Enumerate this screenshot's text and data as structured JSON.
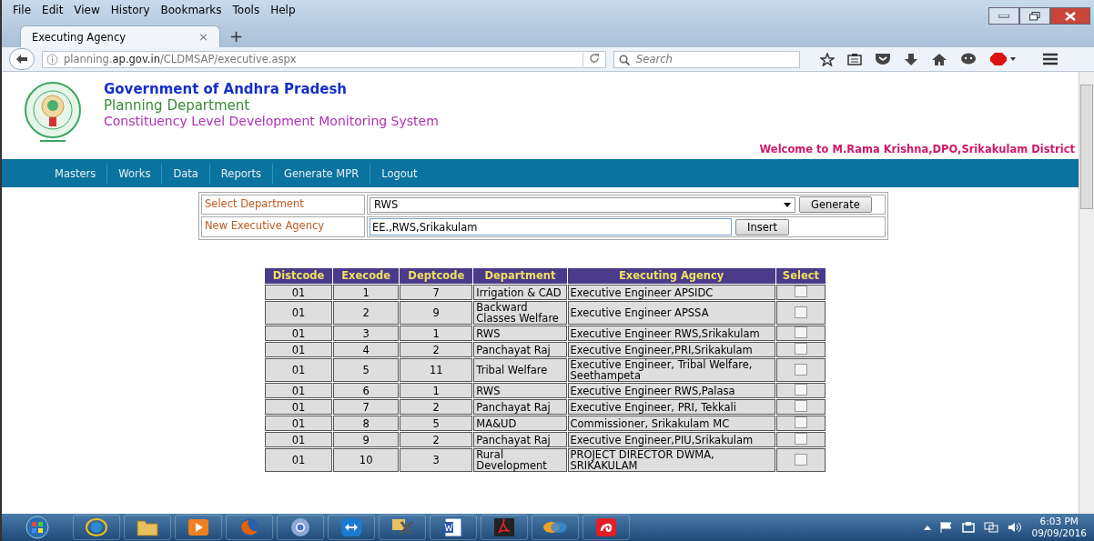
{
  "menu": [
    "File",
    "Edit",
    "View",
    "History",
    "Bookmarks",
    "Tools",
    "Help"
  ],
  "tabs": [
    {
      "label": "Executing Agency",
      "selected": true,
      "close": "×"
    }
  ],
  "new_tab": "+",
  "address": {
    "pre": "planning.",
    "host": "ap.gov.in",
    "path": "/CLDMSAP/executive.aspx"
  },
  "search": {
    "placeholder": "Search"
  },
  "header": {
    "title": "Government of Andhra Pradesh",
    "subtitle": "Planning Department",
    "system": "Constituency Level Development Monitoring System",
    "welcome": "Welcome to M.Rama Krishna,DPO,Srikakulam District"
  },
  "nav": [
    "Masters",
    "Works",
    "Data",
    "Reports",
    "Generate MPR",
    "Logout"
  ],
  "form": {
    "department_label": "Select Department",
    "department": "RWS",
    "generate": "Generate",
    "agency_label": "New Executive Agency",
    "agency": "EE.,RWS,Srikakulam",
    "insert": "Insert"
  },
  "table": {
    "columns": [
      "Distcode",
      "Execode",
      "Deptcode",
      "Department",
      "Executing Agency",
      "Select"
    ],
    "rows": [
      {
        "dist": "01",
        "exe": "1",
        "dept": "7",
        "department": "Irrigation & CAD",
        "agency": "Executive Engineer APSIDC",
        "checked": false
      },
      {
        "dist": "01",
        "exe": "2",
        "dept": "9",
        "department": "Backward Classes Welfare",
        "agency": "Executive Engineer APSSA",
        "checked": false
      },
      {
        "dist": "01",
        "exe": "3",
        "dept": "1",
        "department": "RWS",
        "agency": "Executive Engineer RWS,Srikakulam",
        "checked": false
      },
      {
        "dist": "01",
        "exe": "4",
        "dept": "2",
        "department": "Panchayat Raj",
        "agency": "Executive Engineer,PRI,Srikakulam",
        "checked": false
      },
      {
        "dist": "01",
        "exe": "5",
        "dept": "11",
        "department": "Tribal Welfare",
        "agency": "Executive Engineer, Tribal Welfare, Seethampeta",
        "checked": false
      },
      {
        "dist": "01",
        "exe": "6",
        "dept": "1",
        "department": "RWS",
        "agency": "Executive Engineer RWS,Palasa",
        "checked": false
      },
      {
        "dist": "01",
        "exe": "7",
        "dept": "2",
        "department": "Panchayat Raj",
        "agency": "Executive Engineer, PRI, Tekkali",
        "checked": false
      },
      {
        "dist": "01",
        "exe": "8",
        "dept": "5",
        "department": "MA&UD",
        "agency": "Commissioner, Srikakulam MC",
        "checked": false
      },
      {
        "dist": "01",
        "exe": "9",
        "dept": "2",
        "department": "Panchayat Raj",
        "agency": "Executive Engineer,PIU,Srikakulam",
        "checked": false
      },
      {
        "dist": "01",
        "exe": "10",
        "dept": "3",
        "department": "Rural Development",
        "agency": "PROJECT DIRECTOR DWMA, SRIKAKULAM",
        "checked": false
      }
    ]
  },
  "taskbar": {
    "apps": [
      {
        "kind": "start"
      },
      {
        "kind": "ie"
      },
      {
        "kind": "folder"
      },
      {
        "kind": "media"
      },
      {
        "kind": "firefox"
      },
      {
        "kind": "chrome"
      },
      {
        "kind": "teamviewer"
      },
      {
        "kind": "tools"
      },
      {
        "kind": "word"
      },
      {
        "kind": "pdf"
      },
      {
        "kind": "app"
      },
      {
        "kind": "airtel"
      }
    ],
    "time": "6:03 PM",
    "date": "09/09/2016"
  }
}
